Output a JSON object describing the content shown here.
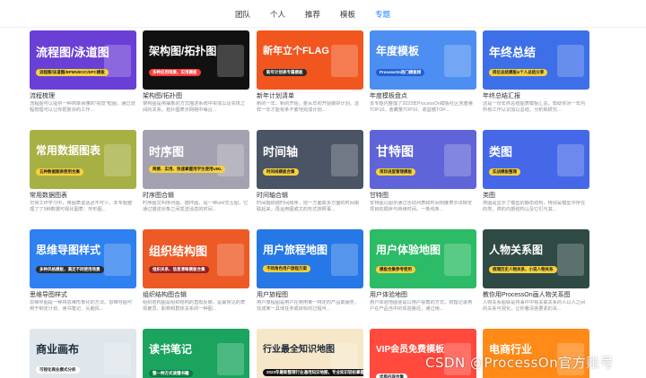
{
  "nav": {
    "tabs": [
      "团队",
      "个人",
      "推荐",
      "模板",
      "专题"
    ],
    "active_tab": "专题"
  },
  "cards": [
    {
      "thumb_title": "流程图/泳道图",
      "thumb_tag": "流程图/泳道图/BPMN/EVC/EPC模板",
      "title": "流程梳理",
      "desc": "流程图可以提供一种简单易懂的\"视觉\"框图，通过流程梳理可以让你把复杂的工作..."
    },
    {
      "thumb_title": "架构图/拓扑图",
      "thumb_tag": "多种应用场景，实用模板",
      "title": "架构图/拓扑图",
      "desc": "架构图是用抽象的方式描述系统中实体以及实体之间的关系。拓扑图表示网络中每台..."
    },
    {
      "thumb_title": "新年立个FLAG",
      "thumb_tag": "新年计划表专属模板",
      "title": "新年计划清单",
      "desc": "新的一年、新的开始，要从年初开始做好计划。这样一年才能有条不紊地完成计划..."
    },
    {
      "thumb_title": "年度模板",
      "thumb_tag": "ProcessOn热门模板榜",
      "title": "年度模板盘点",
      "desc": "本专题内整理了2023年ProcessOn模板社区克隆量TOP10、收藏量TOP10、收益额TOP..."
    },
    {
      "thumb_title": "年终总结",
      "thumb_tag": "岗位总结模板&个人总结分享",
      "title": "年终总结汇报",
      "desc": "这是一份年终总结图表模板汇总，帮助你对一年内所有工作认识加以总结，分析和研究..."
    },
    {
      "thumb_title": "常用数据图表",
      "thumb_tag": "五种数据图表使用合集",
      "title": "常用数据图表",
      "desc": "日常工作学习中，用图表说话必不可少。本专题整理了了5种数据可视化图表：环形图..."
    },
    {
      "thumb_title": "时序图",
      "thumb_tag": "简要、实用、快速掌握用学生使用UML",
      "title": "时序图合辑",
      "desc": "时序图又叫序列图、循环图，是一种uml交互图，它通过描述对象之间发送消息的时间..."
    },
    {
      "thumb_title": "时间轴",
      "thumb_tag": "时间线模板合集",
      "title": "时间轴合辑",
      "desc": "时间轴依据时间顺序，把一方面或多方面的时间串联起来，再运用图或文的形式按照事..."
    },
    {
      "thumb_title": "甘特图",
      "thumb_tag": "项目进度管理模板",
      "title": "甘特图",
      "desc": "甘特图以图示通过活动列表和时间刻度表示出特定项目的顺序与持续时间。一条线条..."
    },
    {
      "thumb_title": "类图",
      "thumb_tag": "实战模板整理",
      "title": "类图",
      "desc": "类图是显示了模型的静态结构，特别是模型中存在的类、类的内部结构以及它们与其..."
    },
    {
      "thumb_title": "思维导图样式",
      "thumb_tag": "多种风格模板，满足不同使用场景",
      "title": "思维导图样式",
      "desc": "思维导图是一种将思维形象化的方法。思维导图可用于制定计划、读书笔记、头脑风..."
    },
    {
      "thumb_title": "组织结构图",
      "thumb_tag": "组织关系、信息清晰模板合集",
      "title": "组织结构图合辑",
      "desc": "组织结构图是组织结构的直观反映，是最常见的表现雇员、职称和群体关系的一种图..."
    },
    {
      "thumb_title": "用户旅程地图",
      "thumb_tag": "不同角色用户旅程方案",
      "title": "用户旅程图",
      "desc": "用户旅程图是用户在使用某一特定的产品或服务，完成某一具体任务或目标的过程可..."
    },
    {
      "thumb_title": "用户体验地图",
      "thumb_tag": "模板合集参考使用",
      "title": "用户体验地图",
      "desc": "用户体验地图便是以用户视角的方式，梳理记录用户在产品当中的体验路径，通过用..."
    },
    {
      "thumb_title": "人物关系图",
      "thumb_tag": "梳理历史人物关系、小说人物关系",
      "title": "教你用ProcessOn画人物关系图",
      "desc": "人物关系图就是将事件中有关联关系的人以人之间的关系可视化，让你看清各要素的关..."
    },
    {
      "thumb_title": "商业画布",
      "thumb_tag": "可视化商业模式分析",
      "title": "",
      "desc": ""
    },
    {
      "thumb_title": "读书笔记",
      "thumb_tag": "整一种方式读懂书籍",
      "title": "",
      "desc": ""
    },
    {
      "thumb_title": "行业最全知识地图",
      "thumb_tag": "2023年最新整理行业通用知识地图，专业知识轻松掌握",
      "title": "",
      "desc": ""
    },
    {
      "thumb_title": "VIP会员免费模板",
      "thumb_tag": "优质内容合集",
      "title": "",
      "desc": ""
    },
    {
      "thumb_title": "电商行业",
      "thumb_tag": "",
      "title": "",
      "desc": ""
    }
  ],
  "colors": {
    "accent": "#1f7bff",
    "thumbs": [
      "#6a3fd6",
      "#111111",
      "#f2561f",
      "#4c8ef2",
      "#3d6fe8",
      "#a7b043",
      "#a4a2b0",
      "#4b5464",
      "#5f64d8",
      "#4468e8",
      "#2f80f0",
      "#ee5a26",
      "#2678e6",
      "#2cbb66",
      "#2f4a45",
      "#dfe6ec",
      "#1aa45e",
      "#f5e7c8",
      "#ff4a3d",
      "#ff8a18"
    ],
    "tag_bg": [
      "#f7d23b",
      "#ff3b3b",
      "#2b2b2b",
      "#1f5fd1",
      "#f7d23b",
      "#f7d23b",
      "#f7d23b",
      "#f7d23b",
      "#f7d23b",
      "#f7d23b",
      "#2b2b2b",
      "#8c1f1f",
      "#f7d23b",
      "#f7d23b",
      "#f7d23b",
      "#ffffff",
      "#0e7b43",
      "#111111",
      "#ffffff",
      "#ffffff"
    ]
  },
  "watermark": "CSDN @ProcessOn官方账号"
}
